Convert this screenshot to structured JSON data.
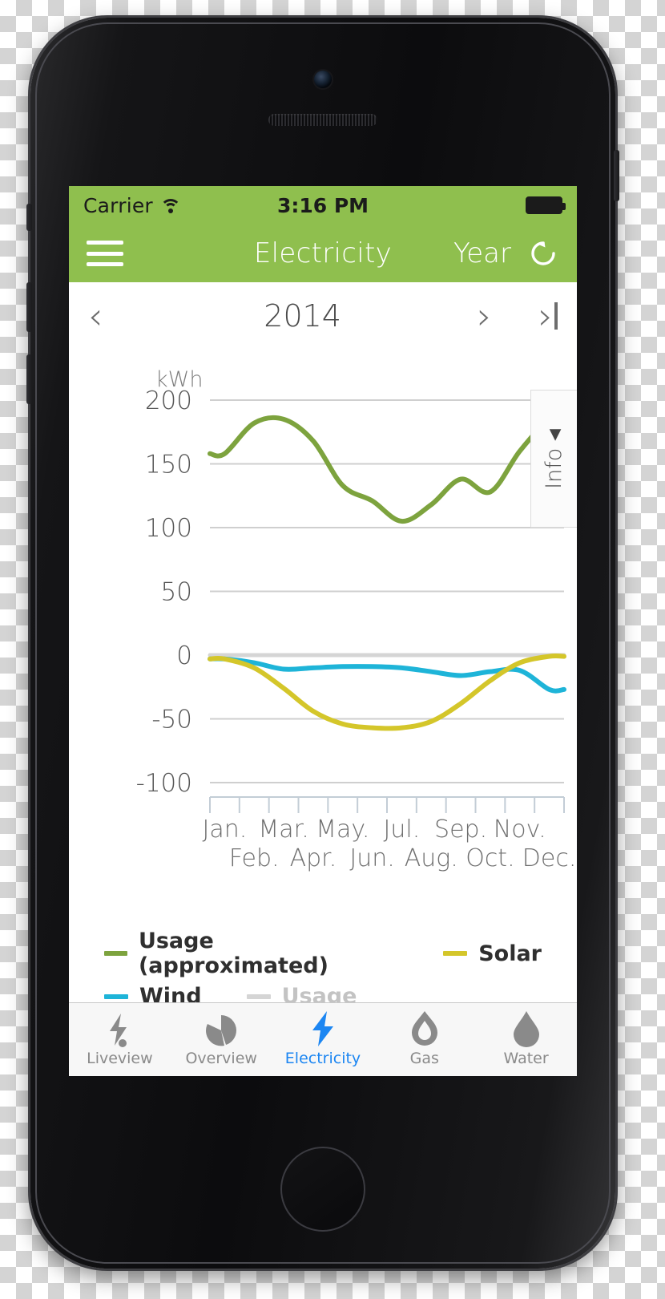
{
  "status_bar": {
    "carrier": "Carrier",
    "wifi_icon": "wifi-icon",
    "time": "3:16 PM",
    "battery_icon": "battery-full-icon"
  },
  "nav_bar": {
    "menu_icon": "hamburger-menu-icon",
    "title": "Electricity",
    "period": "Year",
    "refresh_icon": "refresh-icon",
    "background_color": "#8fbf4e"
  },
  "date_nav": {
    "prev_icon": "chevron-left-icon",
    "current": "2014",
    "next_icon": "chevron-right-icon",
    "last_icon": "chevron-right-bar-icon"
  },
  "info_panel": {
    "label": "Info",
    "caret_icon": "caret-left-icon"
  },
  "legend": [
    {
      "label": "Usage (approximated)",
      "color": "#7da33e",
      "muted": false
    },
    {
      "label": "Solar",
      "color": "#d4c62a",
      "muted": false
    },
    {
      "label": "Wind",
      "color": "#1eb4d8",
      "muted": false
    },
    {
      "label": "Usage",
      "color": "#d5d5d5",
      "muted": true
    }
  ],
  "tabs": [
    {
      "label": "Liveview",
      "icon": "lightning-dot-icon",
      "active": false
    },
    {
      "label": "Overview",
      "icon": "pie-chart-icon",
      "active": false
    },
    {
      "label": "Electricity",
      "icon": "lightning-bolt-icon",
      "active": true
    },
    {
      "label": "Gas",
      "icon": "flame-icon",
      "active": false
    },
    {
      "label": "Water",
      "icon": "water-drop-icon",
      "active": false
    }
  ],
  "colors": {
    "accent_green": "#8fbf4e",
    "usage_line": "#7da33e",
    "solar_line": "#d4c62a",
    "wind_line": "#1eb4d8",
    "inactive_usage": "#d5d5d5",
    "active_tab": "#1c86f2"
  },
  "chart_data": {
    "type": "line",
    "title": "Electricity",
    "subtitle": "2014",
    "ylabel": "kWh",
    "xlabel": "",
    "unit": "kWh",
    "ylim": [
      -100,
      200
    ],
    "yticks": [
      200,
      150,
      100,
      50,
      0,
      -50,
      -100
    ],
    "ytick_labels": [
      "200",
      "150",
      "100",
      "50",
      "0",
      "-50",
      "-100"
    ],
    "grid": true,
    "legend_position": "bottom",
    "categories": [
      "Jan.",
      "Feb.",
      "Mar.",
      "Apr.",
      "May.",
      "Jun.",
      "Jul.",
      "Aug.",
      "Sep.",
      "Oct.",
      "Nov.",
      "Dec."
    ],
    "series": [
      {
        "name": "Usage (approximated)",
        "color": "#7da33e",
        "values": [
          158,
          182,
          185,
          168,
          133,
          121,
          105,
          118,
          138,
          128,
          160,
          185
        ]
      },
      {
        "name": "Solar",
        "color": "#d4c62a",
        "values": [
          -3,
          -10,
          -26,
          -44,
          -54,
          -57,
          -57,
          -52,
          -38,
          -20,
          -6,
          -1
        ]
      },
      {
        "name": "Wind",
        "color": "#1eb4d8",
        "values": [
          -3,
          -6,
          -11,
          -10,
          -9,
          -9,
          -10,
          -13,
          -16,
          -13,
          -12,
          -27
        ]
      },
      {
        "name": "Usage",
        "color": "#d5d5d5",
        "values": [
          0,
          0,
          0,
          0,
          0,
          0,
          0,
          0,
          0,
          0,
          0,
          0
        ]
      }
    ]
  }
}
